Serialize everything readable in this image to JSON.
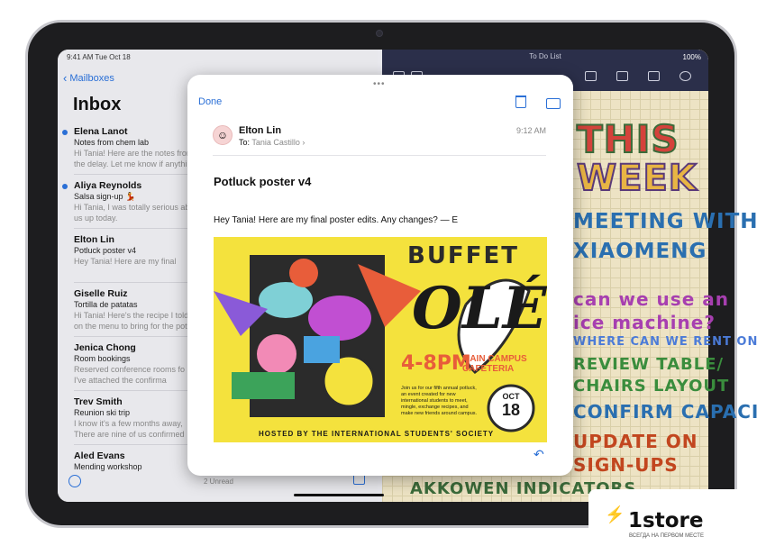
{
  "status_bar": {
    "time_date": "9:41 AM  Tue Oct 18",
    "battery": "100%"
  },
  "mail": {
    "back_label": "Mailboxes",
    "title": "Inbox",
    "messages": [
      {
        "sender": "Elena Lanot",
        "subject": "Notes from chem lab",
        "preview": [
          "Hi Tania! Here are the notes from",
          "the delay. Let me know if anything"
        ],
        "unread": true
      },
      {
        "sender": "Aliya Reynolds",
        "subject": "Salsa sign-up 💃",
        "preview": [
          "Hi Tania, I was totally serious abo",
          "us up today."
        ],
        "unread": true
      },
      {
        "sender": "Elton Lin",
        "subject": "Potluck poster v4",
        "preview": [
          "Hey Tania! Here are my final"
        ],
        "unread": false
      },
      {
        "sender": "Giselle Ruiz",
        "subject": "Tortilla de patatas",
        "preview": [
          "Hi Tania! Here's the recipe I told yo",
          "on the menu to bring for the potlu"
        ],
        "unread": false
      },
      {
        "sender": "Jenica Chong",
        "subject": "Room bookings",
        "preview": [
          "Reserved conference rooms fo",
          "I've attached the confirma"
        ],
        "unread": false
      },
      {
        "sender": "Trev Smith",
        "subject": "Reunion ski trip",
        "preview": [
          "I know it's a few months away,",
          "There are nine of us confirmed"
        ],
        "unread": false
      },
      {
        "sender": "Aled Evans",
        "subject": "Mending workshop",
        "preview": [],
        "unread": false
      }
    ],
    "unread_count": "2 Unread"
  },
  "notes": {
    "title": "To Do List",
    "lines": [
      "THIS",
      "WEEK",
      "MEETING WITH",
      "XIAOMENG",
      "can we use an",
      "ice machine?",
      "WHERE CAN WE RENT ONE?",
      "REVIEW TABLE/",
      "CHAIRS LAYOUT",
      "CONFIRM CAPACITY",
      "UPDATE ON",
      "SIGN-UPS",
      "AKKOWEN INDICATORS"
    ]
  },
  "sheet": {
    "done_label": "Done",
    "from": "Elton Lin",
    "to_label": "To:",
    "to_name": "Tania Castillo",
    "time": "9:12 AM",
    "subject": "Potluck poster v4",
    "body": "Hey Tania! Here are my final poster edits. Any changes? — E",
    "poster": {
      "headline_1": "BUFFET",
      "headline_2": "OLÉ",
      "time_place": "4-8PM",
      "place": "MAIN CAMPUS CAFETERIA",
      "blurb": [
        "Join us for our fifth annual potluck,",
        "an event created for new",
        "international students to meet,",
        "mingle, exchange recipes, and",
        "make new friends around campus."
      ],
      "date_top": "OCT",
      "date_day": "18",
      "hosted_by": "HOSTED BY THE INTERNATIONAL STUDENTS' SOCIETY"
    }
  },
  "brand": {
    "name": "1store",
    "tagline": "ВСЕГДА НА ПЕРВОМ МЕСТЕ"
  }
}
